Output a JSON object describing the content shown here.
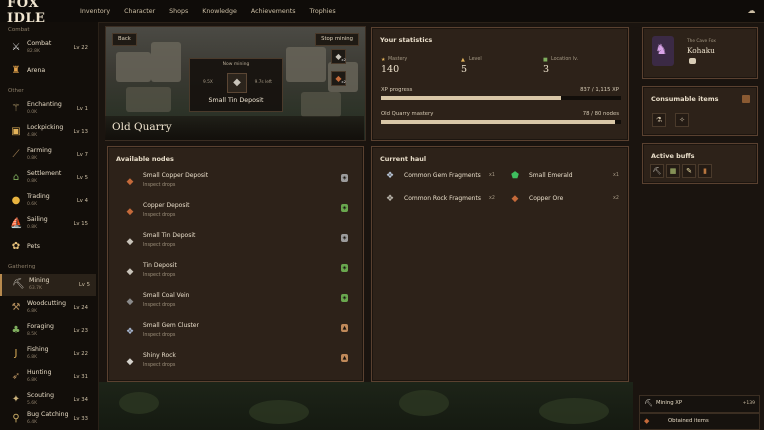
{
  "app": {
    "logo": "FOX IDLE"
  },
  "topnav": [
    "Inventory",
    "Character",
    "Shops",
    "Knowledge",
    "Achievements",
    "Trophies"
  ],
  "sidebar": {
    "sections": [
      {
        "title": "Combat",
        "items": [
          {
            "name": "Combat",
            "xp": "82.8K",
            "level": "Lv 22",
            "icon": "sword-icon"
          },
          {
            "name": "Arena",
            "xp": "",
            "level": "",
            "icon": "arena-icon"
          }
        ]
      },
      {
        "title": "Other",
        "items": [
          {
            "name": "Enchanting",
            "xp": "0.0K",
            "level": "Lv 1",
            "icon": "wand-icon"
          },
          {
            "name": "Lockpicking",
            "xp": "4.8K",
            "level": "Lv 13",
            "icon": "lockpick-icon"
          },
          {
            "name": "Farming",
            "xp": "0.8K",
            "level": "Lv 7",
            "icon": "hoe-icon"
          },
          {
            "name": "Settlement",
            "xp": "0.8K",
            "level": "Lv 5",
            "icon": "settlement-icon"
          },
          {
            "name": "Trading",
            "xp": "0.6K",
            "level": "Lv 4",
            "icon": "coin-icon"
          },
          {
            "name": "Sailing",
            "xp": "0.8K",
            "level": "Lv 15",
            "icon": "ship-icon"
          },
          {
            "name": "Pets",
            "xp": "",
            "level": "",
            "icon": "paw-icon"
          }
        ]
      },
      {
        "title": "Gathering",
        "items": [
          {
            "name": "Mining",
            "xp": "63.7K",
            "level": "Lv 5",
            "icon": "pickaxe-icon",
            "active": true
          },
          {
            "name": "Woodcutting",
            "xp": "6.8K",
            "level": "Lv 24",
            "icon": "axe-icon"
          },
          {
            "name": "Foraging",
            "xp": "8.5K",
            "level": "Lv 23",
            "icon": "herb-icon"
          },
          {
            "name": "Fishing",
            "xp": "6.8K",
            "level": "Lv 22",
            "icon": "hook-icon"
          },
          {
            "name": "Hunting",
            "xp": "6.8K",
            "level": "Lv 31",
            "icon": "bow-icon"
          },
          {
            "name": "Scouting",
            "xp": "5.6K",
            "level": "Lv 34",
            "icon": "compass-icon"
          },
          {
            "name": "Bug Catching",
            "xp": "6.4K",
            "level": "Lv 33",
            "icon": "net-icon"
          }
        ]
      }
    ]
  },
  "scene": {
    "back_label": "Back",
    "stop_label": "Stop mining",
    "now_mining_label": "Now mining",
    "left_stat": "9.5X",
    "right_stat": "9.7s left",
    "current_node": "Small Tin Deposit",
    "location_title": "Old Quarry",
    "side_counts": [
      "x2",
      "x2"
    ]
  },
  "statistics": {
    "title": "Your statistics",
    "mastery_label": "Mastery",
    "mastery_value": "140",
    "level_label": "Level",
    "level_value": "5",
    "location_label": "Location lv.",
    "location_value": "3",
    "xp_label": "XP progress",
    "xp_value": "837 / 1,115 XP",
    "xp_fraction": 0.75,
    "mastery_bar_label": "Old Quarry mastery",
    "mastery_bar_value": "78 / 80 nodes",
    "mastery_fraction": 0.975
  },
  "nodes": {
    "title": "Available nodes",
    "sub_label": "Inspect drops",
    "items": [
      {
        "name": "Small Copper Deposit",
        "icon": "copper-ore-icon",
        "badge_color": "#9c9c9c",
        "badge_icon": "shield-icon"
      },
      {
        "name": "Copper Deposit",
        "icon": "copper-ore-icon",
        "badge_color": "#6aa84f",
        "badge_icon": "shield-icon"
      },
      {
        "name": "Small Tin Deposit",
        "icon": "tin-ore-icon",
        "badge_color": "#9c9c9c",
        "badge_icon": "shield-icon"
      },
      {
        "name": "Tin Deposit",
        "icon": "tin-ore-icon",
        "badge_color": "#6aa84f",
        "badge_icon": "shield-icon"
      },
      {
        "name": "Small Coal Vein",
        "icon": "coal-icon",
        "badge_color": "#6aa84f",
        "badge_icon": "shield-icon"
      },
      {
        "name": "Small Gem Cluster",
        "icon": "gem-cluster-icon",
        "badge_color": "#c08a5a",
        "badge_icon": "lock-icon"
      },
      {
        "name": "Shiny Rock",
        "icon": "shiny-rock-icon",
        "badge_color": "#c08a5a",
        "badge_icon": "lock-icon"
      }
    ]
  },
  "haul": {
    "title": "Current haul",
    "items": [
      {
        "name": "Common Gem Fragments",
        "qty": "x1",
        "icon": "gem-fragment-icon",
        "color": "#b7c4d6"
      },
      {
        "name": "Small Emerald",
        "qty": "x1",
        "icon": "emerald-icon",
        "color": "#3fbf5f"
      },
      {
        "name": "Common Rock Fragments",
        "qty": "x2",
        "icon": "rock-fragment-icon",
        "color": "#b9b4aa"
      },
      {
        "name": "Copper Ore",
        "qty": "x2",
        "icon": "copper-ore-icon",
        "color": "#c56a3a"
      }
    ]
  },
  "profile": {
    "subtitle": "The Cave Fox",
    "name": "Kohaku"
  },
  "consumables": {
    "title": "Consumable items"
  },
  "buffs": {
    "title": "Active buffs"
  },
  "notifications": [
    {
      "label": "Mining XP",
      "value": "+139",
      "icon": "pickaxe-icon"
    },
    {
      "label": "Obtained items",
      "value": "",
      "icon": "bag-icon"
    }
  ],
  "colors": {
    "accent": "#b88a4e",
    "panel_border": "#5a4130",
    "panel_bg": "#2d2219"
  }
}
